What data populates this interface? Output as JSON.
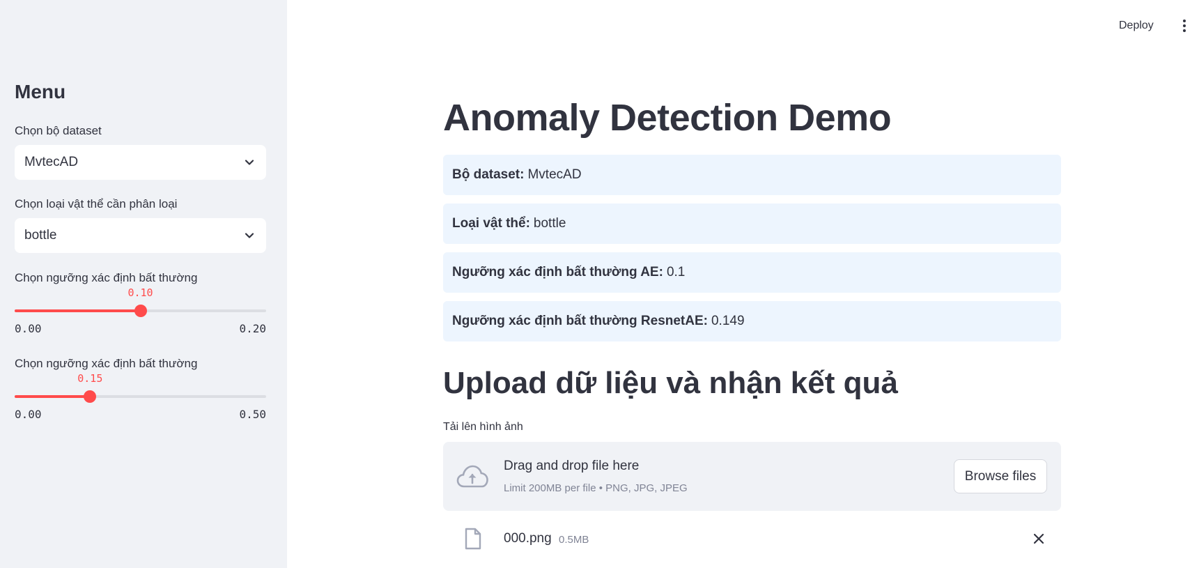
{
  "header": {
    "deploy_label": "Deploy",
    "menu_icon": "kebab-menu-icon"
  },
  "sidebar": {
    "title": "Menu",
    "dataset_label": "Chọn bộ dataset",
    "dataset_value": "MvtecAD",
    "object_label": "Chọn loại vật thể cần phân loại",
    "object_value": "bottle",
    "slider1": {
      "label": "Chọn ngưỡng xác định bất thường",
      "value": "0.10",
      "min": "0.00",
      "max": "0.20",
      "fraction": 0.5
    },
    "slider2": {
      "label": "Chọn ngưỡng xác định bất thường",
      "value": "0.15",
      "min": "0.00",
      "max": "0.50",
      "fraction": 0.3
    }
  },
  "main": {
    "title": "Anomaly Detection Demo",
    "info": [
      {
        "key": "Bộ dataset:",
        "value": "MvtecAD"
      },
      {
        "key": "Loại vật thể:",
        "value": "bottle"
      },
      {
        "key": "Ngưỡng xác định bất thường AE:",
        "value": "0.1"
      },
      {
        "key": "Ngưỡng xác định bất thường ResnetAE:",
        "value": "0.149"
      }
    ],
    "upload_title": "Upload dữ liệu và nhận kết quả",
    "upload_label": "Tải lên hình ảnh",
    "dropzone": {
      "title": "Drag and drop file here",
      "subtitle": "Limit 200MB per file • PNG, JPG, JPEG",
      "browse_label": "Browse files"
    },
    "file": {
      "name": "000.png",
      "size": "0.5MB"
    }
  },
  "colors": {
    "accent": "#ff4b4b",
    "sidebar_bg": "#f0f2f6",
    "info_bg": "#edf5fe",
    "text": "#31333f"
  }
}
